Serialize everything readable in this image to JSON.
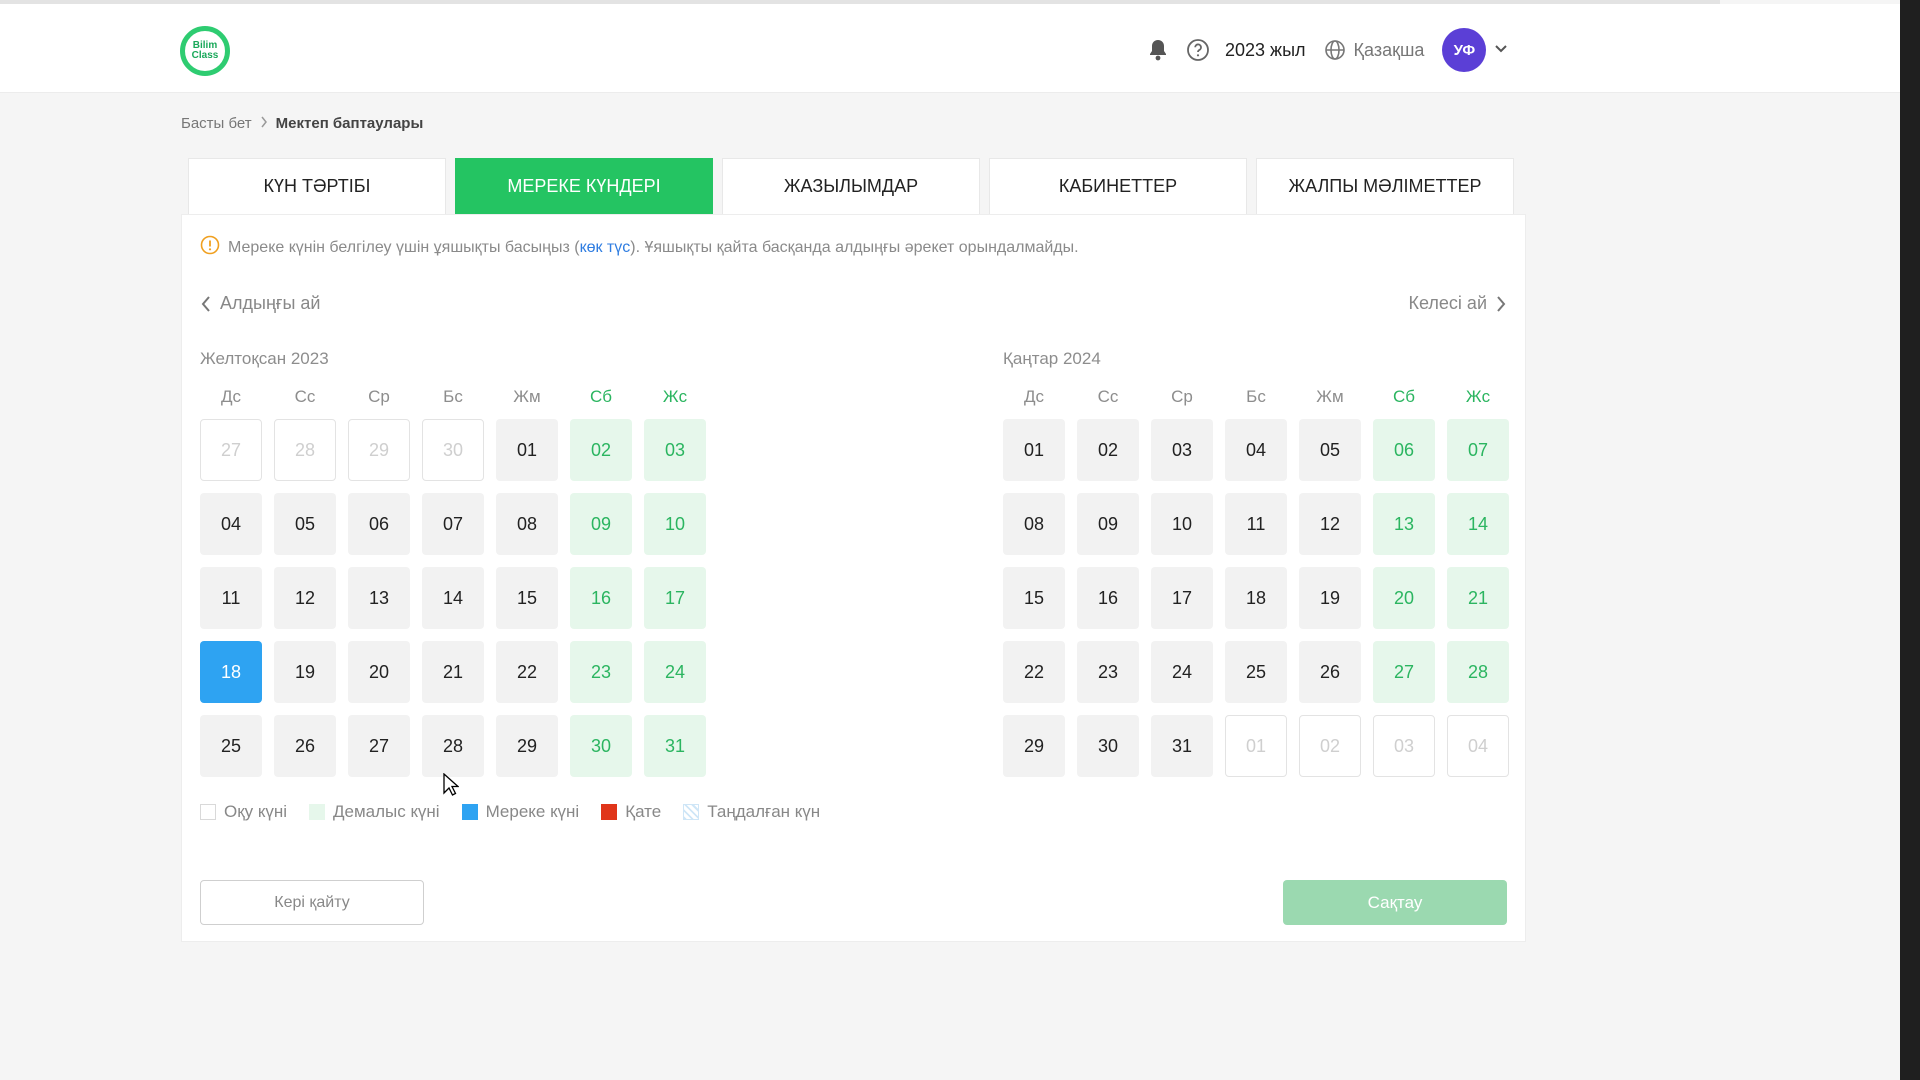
{
  "header": {
    "logo_text": "Bilim Class",
    "year": "2023 жыл",
    "language": "Қазақша",
    "avatar_initials": "УФ",
    "icons": [
      "bell-icon",
      "help-icon",
      "globe-icon",
      "chevron-down-icon"
    ]
  },
  "breadcrumb": {
    "home": "Басты бет",
    "current": "Мектеп баптаулары"
  },
  "tabs": [
    "КҮН ТӘРТІБІ",
    "МЕРЕКЕ КҮНДЕРІ",
    "ЖАЗЫЛЫМДАР",
    "КАБИНЕТТЕР",
    "ЖАЛПЫ МӘЛІМЕТТЕР"
  ],
  "active_tab": 1,
  "info": {
    "before": "Мереке күнін белгілеу үшін ұяшықты басыңыз (",
    "link": "көк түс",
    "after": "). Ұяшықты қайта басқанда алдыңғы әрекет орындалмайды."
  },
  "nav": {
    "prev": "Алдыңғы ай",
    "next": "Келесі ай"
  },
  "weekdays": [
    "Дс",
    "Сс",
    "Ср",
    "Бс",
    "Жм",
    "Сб",
    "Жс"
  ],
  "months": [
    {
      "title": "Желтоқсан 2023",
      "days": [
        {
          "d": "27",
          "t": "out"
        },
        {
          "d": "28",
          "t": "out"
        },
        {
          "d": "29",
          "t": "out"
        },
        {
          "d": "30",
          "t": "out"
        },
        {
          "d": "01",
          "t": "school"
        },
        {
          "d": "02",
          "t": "weekend"
        },
        {
          "d": "03",
          "t": "weekend"
        },
        {
          "d": "04",
          "t": "school"
        },
        {
          "d": "05",
          "t": "school"
        },
        {
          "d": "06",
          "t": "school"
        },
        {
          "d": "07",
          "t": "school"
        },
        {
          "d": "08",
          "t": "school"
        },
        {
          "d": "09",
          "t": "weekend"
        },
        {
          "d": "10",
          "t": "weekend"
        },
        {
          "d": "11",
          "t": "school"
        },
        {
          "d": "12",
          "t": "school"
        },
        {
          "d": "13",
          "t": "school"
        },
        {
          "d": "14",
          "t": "school"
        },
        {
          "d": "15",
          "t": "school"
        },
        {
          "d": "16",
          "t": "weekend"
        },
        {
          "d": "17",
          "t": "weekend"
        },
        {
          "d": "18",
          "t": "holiday"
        },
        {
          "d": "19",
          "t": "school"
        },
        {
          "d": "20",
          "t": "school"
        },
        {
          "d": "21",
          "t": "school"
        },
        {
          "d": "22",
          "t": "school"
        },
        {
          "d": "23",
          "t": "weekend"
        },
        {
          "d": "24",
          "t": "weekend"
        },
        {
          "d": "25",
          "t": "school"
        },
        {
          "d": "26",
          "t": "school"
        },
        {
          "d": "27",
          "t": "school"
        },
        {
          "d": "28",
          "t": "school"
        },
        {
          "d": "29",
          "t": "school"
        },
        {
          "d": "30",
          "t": "weekend"
        },
        {
          "d": "31",
          "t": "weekend"
        }
      ]
    },
    {
      "title": "Қаңтар 2024",
      "days": [
        {
          "d": "01",
          "t": "school"
        },
        {
          "d": "02",
          "t": "school"
        },
        {
          "d": "03",
          "t": "school"
        },
        {
          "d": "04",
          "t": "school"
        },
        {
          "d": "05",
          "t": "school"
        },
        {
          "d": "06",
          "t": "weekend"
        },
        {
          "d": "07",
          "t": "weekend"
        },
        {
          "d": "08",
          "t": "school"
        },
        {
          "d": "09",
          "t": "school"
        },
        {
          "d": "10",
          "t": "school"
        },
        {
          "d": "11",
          "t": "school"
        },
        {
          "d": "12",
          "t": "school"
        },
        {
          "d": "13",
          "t": "weekend"
        },
        {
          "d": "14",
          "t": "weekend"
        },
        {
          "d": "15",
          "t": "school"
        },
        {
          "d": "16",
          "t": "school"
        },
        {
          "d": "17",
          "t": "school"
        },
        {
          "d": "18",
          "t": "school"
        },
        {
          "d": "19",
          "t": "school"
        },
        {
          "d": "20",
          "t": "weekend"
        },
        {
          "d": "21",
          "t": "weekend"
        },
        {
          "d": "22",
          "t": "school"
        },
        {
          "d": "23",
          "t": "school"
        },
        {
          "d": "24",
          "t": "school"
        },
        {
          "d": "25",
          "t": "school"
        },
        {
          "d": "26",
          "t": "school"
        },
        {
          "d": "27",
          "t": "weekend"
        },
        {
          "d": "28",
          "t": "weekend"
        },
        {
          "d": "29",
          "t": "school"
        },
        {
          "d": "30",
          "t": "school"
        },
        {
          "d": "31",
          "t": "school"
        },
        {
          "d": "01",
          "t": "out"
        },
        {
          "d": "02",
          "t": "out"
        },
        {
          "d": "03",
          "t": "out"
        },
        {
          "d": "04",
          "t": "out"
        }
      ]
    }
  ],
  "legend": {
    "school": "Оқу күні",
    "rest": "Демалыс күні",
    "holiday": "Мереке күні",
    "error": "Қате",
    "selected": "Таңдалған күн"
  },
  "buttons": {
    "back": "Кері қайту",
    "save": "Сақтау"
  },
  "colors": {
    "accent_green": "#24c462",
    "holiday_blue": "#2ea3f2",
    "error_red": "#e0351a",
    "avatar": "#5b3fd6"
  }
}
